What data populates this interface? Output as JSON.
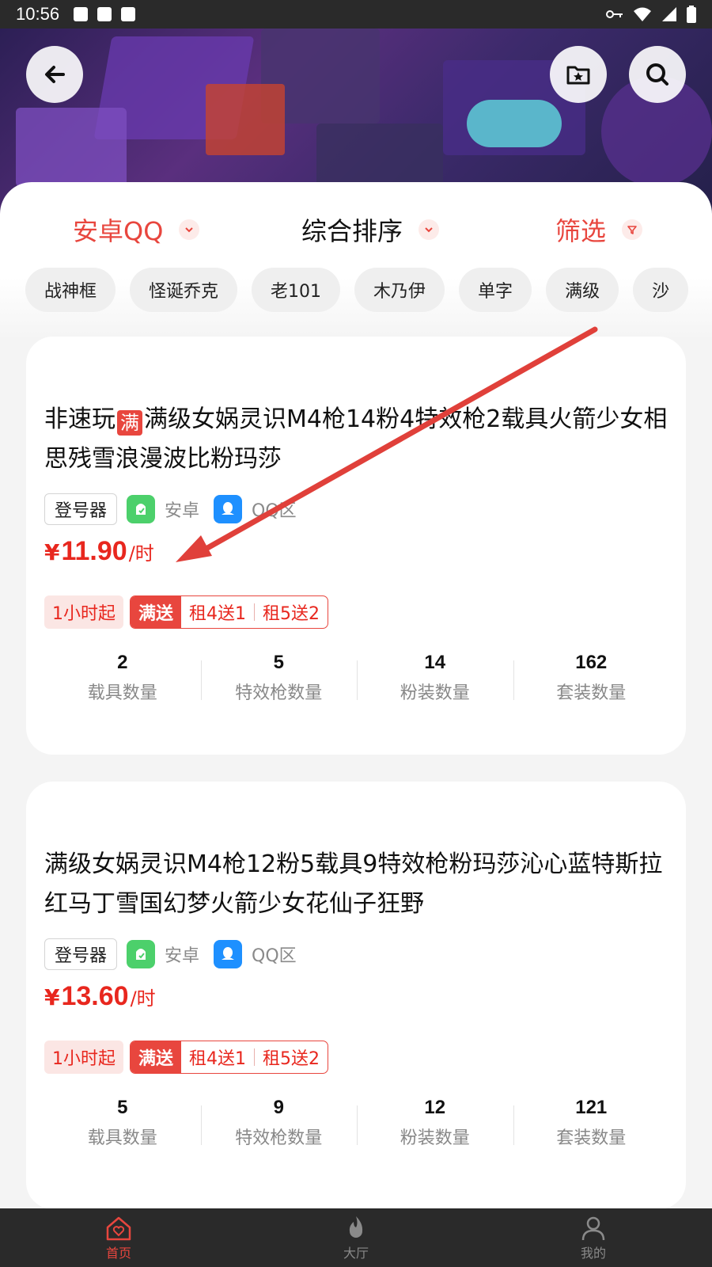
{
  "status_bar": {
    "time": "10:56"
  },
  "sort_bar": {
    "platform": "安卓QQ",
    "sort": "综合排序",
    "filter": "筛选"
  },
  "tags": [
    "战神框",
    "怪诞乔克",
    "老101",
    "木乃伊",
    "单字",
    "满级",
    "沙"
  ],
  "listings": [
    {
      "title_prefix": "非速玩",
      "title_badge": "满",
      "title_rest": "满级女娲灵识M4枪14粉4特效枪2载具火箭少女相思残雪浪漫波比粉玛莎",
      "login_tool": "登号器",
      "platform": "安卓",
      "region": "QQ区",
      "currency": "¥",
      "price": "11.90",
      "unit": "/时",
      "min_hours": "1小时起",
      "deal_title": "满送",
      "deal_1": "租4送1",
      "deal_2": "租5送2",
      "stats": [
        {
          "value": "2",
          "label": "载具数量"
        },
        {
          "value": "5",
          "label": "特效枪数量"
        },
        {
          "value": "14",
          "label": "粉装数量"
        },
        {
          "value": "162",
          "label": "套装数量"
        }
      ]
    },
    {
      "title_prefix": "",
      "title_badge": "",
      "title_rest": "满级女娲灵识M4枪12粉5载具9特效枪粉玛莎沁心蓝特斯拉红马丁雪国幻梦火箭少女花仙子狂野",
      "login_tool": "登号器",
      "platform": "安卓",
      "region": "QQ区",
      "currency": "¥",
      "price": "13.60",
      "unit": "/时",
      "min_hours": "1小时起",
      "deal_title": "满送",
      "deal_1": "租4送1",
      "deal_2": "租5送2",
      "stats": [
        {
          "value": "5",
          "label": "载具数量"
        },
        {
          "value": "9",
          "label": "特效枪数量"
        },
        {
          "value": "12",
          "label": "粉装数量"
        },
        {
          "value": "121",
          "label": "套装数量"
        }
      ]
    }
  ],
  "bottom_nav": [
    {
      "label": "首页",
      "icon": "home-icon",
      "active": true
    },
    {
      "label": "大厅",
      "icon": "flame-icon",
      "active": false
    },
    {
      "label": "我的",
      "icon": "user-icon",
      "active": false
    }
  ],
  "colors": {
    "accent": "#e8463e",
    "price": "#e8271e",
    "android": "#4cd06b",
    "qq": "#1e90ff",
    "annotation_arrow": "#e0403a"
  }
}
